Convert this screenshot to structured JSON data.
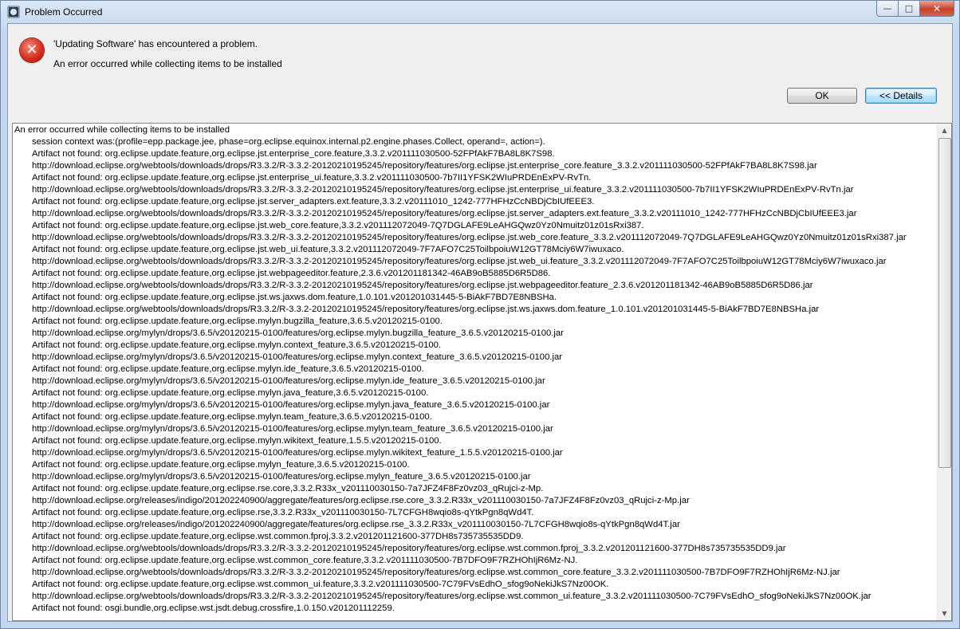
{
  "window": {
    "title": "Problem Occurred",
    "controls": {
      "minimize": "—",
      "maximize": "□",
      "close": "✕"
    }
  },
  "dialog": {
    "icon": "error-icon",
    "message": "'Updating Software' has encountered a problem.",
    "detail": "An error occurred while collecting items to be installed",
    "ok_label": "OK",
    "details_label": "<< Details"
  },
  "details": {
    "lines": [
      "An error occurred while collecting items to be installed",
      "session context was:(profile=epp.package.jee, phase=org.eclipse.equinox.internal.p2.engine.phases.Collect, operand=, action=).",
      "Artifact not found: org.eclipse.update.feature,org.eclipse.jst.enterprise_core.feature,3.3.2.v201111030500-52FPfAkF7BA8L8K7S98.",
      "http://download.eclipse.org/webtools/downloads/drops/R3.3.2/R-3.3.2-20120210195245/repository/features/org.eclipse.jst.enterprise_core.feature_3.3.2.v201111030500-52FPfAkF7BA8L8K7S98.jar",
      "Artifact not found: org.eclipse.update.feature,org.eclipse.jst.enterprise_ui.feature,3.3.2.v201111030500-7b7II1YFSK2WIuPRDEnExPV-RvTn.",
      "http://download.eclipse.org/webtools/downloads/drops/R3.3.2/R-3.3.2-20120210195245/repository/features/org.eclipse.jst.enterprise_ui.feature_3.3.2.v201111030500-7b7II1YFSK2WIuPRDEnExPV-RvTn.jar",
      "Artifact not found: org.eclipse.update.feature,org.eclipse.jst.server_adapters.ext.feature,3.3.2.v20111010_1242-777HFHzCcNBDjCbIUfEEE3.",
      "http://download.eclipse.org/webtools/downloads/drops/R3.3.2/R-3.3.2-20120210195245/repository/features/org.eclipse.jst.server_adapters.ext.feature_3.3.2.v20111010_1242-777HFHzCcNBDjCbIUfEEE3.jar",
      "Artifact not found: org.eclipse.update.feature,org.eclipse.jst.web_core.feature,3.3.2.v201112072049-7Q7DGLAFE9LeAHGQwz0Yz0Nmuitz01z01sRxi387.",
      "http://download.eclipse.org/webtools/downloads/drops/R3.3.2/R-3.3.2-20120210195245/repository/features/org.eclipse.jst.web_core.feature_3.3.2.v201112072049-7Q7DGLAFE9LeAHGQwz0Yz0Nmuitz01z01sRxi387.jar",
      "Artifact not found: org.eclipse.update.feature,org.eclipse.jst.web_ui.feature,3.3.2.v201112072049-7F7AFO7C25ToilbpoiuW12GT78Mciy6W7iwuxaco.",
      "http://download.eclipse.org/webtools/downloads/drops/R3.3.2/R-3.3.2-20120210195245/repository/features/org.eclipse.jst.web_ui.feature_3.3.2.v201112072049-7F7AFO7C25ToilbpoiuW12GT78Mciy6W7iwuxaco.jar",
      "Artifact not found: org.eclipse.update.feature,org.eclipse.jst.webpageeditor.feature,2.3.6.v201201181342-46AB9oB5885D6R5D86.",
      "http://download.eclipse.org/webtools/downloads/drops/R3.3.2/R-3.3.2-20120210195245/repository/features/org.eclipse.jst.webpageeditor.feature_2.3.6.v201201181342-46AB9oB5885D6R5D86.jar",
      "Artifact not found: org.eclipse.update.feature,org.eclipse.jst.ws.jaxws.dom.feature,1.0.101.v201201031445-5-BiAkF7BD7E8NBSHa.",
      "http://download.eclipse.org/webtools/downloads/drops/R3.3.2/R-3.3.2-20120210195245/repository/features/org.eclipse.jst.ws.jaxws.dom.feature_1.0.101.v201201031445-5-BiAkF7BD7E8NBSHa.jar",
      "Artifact not found: org.eclipse.update.feature,org.eclipse.mylyn.bugzilla_feature,3.6.5.v20120215-0100.",
      "http://download.eclipse.org/mylyn/drops/3.6.5/v20120215-0100/features/org.eclipse.mylyn.bugzilla_feature_3.6.5.v20120215-0100.jar",
      "Artifact not found: org.eclipse.update.feature,org.eclipse.mylyn.context_feature,3.6.5.v20120215-0100.",
      "http://download.eclipse.org/mylyn/drops/3.6.5/v20120215-0100/features/org.eclipse.mylyn.context_feature_3.6.5.v20120215-0100.jar",
      "Artifact not found: org.eclipse.update.feature,org.eclipse.mylyn.ide_feature,3.6.5.v20120215-0100.",
      "http://download.eclipse.org/mylyn/drops/3.6.5/v20120215-0100/features/org.eclipse.mylyn.ide_feature_3.6.5.v20120215-0100.jar",
      "Artifact not found: org.eclipse.update.feature,org.eclipse.mylyn.java_feature,3.6.5.v20120215-0100.",
      "http://download.eclipse.org/mylyn/drops/3.6.5/v20120215-0100/features/org.eclipse.mylyn.java_feature_3.6.5.v20120215-0100.jar",
      "Artifact not found: org.eclipse.update.feature,org.eclipse.mylyn.team_feature,3.6.5.v20120215-0100.",
      "http://download.eclipse.org/mylyn/drops/3.6.5/v20120215-0100/features/org.eclipse.mylyn.team_feature_3.6.5.v20120215-0100.jar",
      "Artifact not found: org.eclipse.update.feature,org.eclipse.mylyn.wikitext_feature,1.5.5.v20120215-0100.",
      "http://download.eclipse.org/mylyn/drops/3.6.5/v20120215-0100/features/org.eclipse.mylyn.wikitext_feature_1.5.5.v20120215-0100.jar",
      "Artifact not found: org.eclipse.update.feature,org.eclipse.mylyn_feature,3.6.5.v20120215-0100.",
      "http://download.eclipse.org/mylyn/drops/3.6.5/v20120215-0100/features/org.eclipse.mylyn_feature_3.6.5.v20120215-0100.jar",
      "Artifact not found: org.eclipse.update.feature,org.eclipse.rse.core,3.3.2.R33x_v201110030150-7a7JFZ4F8Fz0vz03_qRujci-z-Mp.",
      "http://download.eclipse.org/releases/indigo/201202240900/aggregate/features/org.eclipse.rse.core_3.3.2.R33x_v201110030150-7a7JFZ4F8Fz0vz03_qRujci-z-Mp.jar",
      "Artifact not found: org.eclipse.update.feature,org.eclipse.rse,3.3.2.R33x_v201110030150-7L7CFGH8wqio8s-qYtkPgn8qWd4T.",
      "http://download.eclipse.org/releases/indigo/201202240900/aggregate/features/org.eclipse.rse_3.3.2.R33x_v201110030150-7L7CFGH8wqio8s-qYtkPgn8qWd4T.jar",
      "Artifact not found: org.eclipse.update.feature,org.eclipse.wst.common.fproj,3.3.2.v201201121600-377DH8s735735535DD9.",
      "http://download.eclipse.org/webtools/downloads/drops/R3.3.2/R-3.3.2-20120210195245/repository/features/org.eclipse.wst.common.fproj_3.3.2.v201201121600-377DH8s735735535DD9.jar",
      "Artifact not found: org.eclipse.update.feature,org.eclipse.wst.common_core.feature,3.3.2.v201111030500-7B7DFO9F7RZHOhIjR6Mz-NJ.",
      "http://download.eclipse.org/webtools/downloads/drops/R3.3.2/R-3.3.2-20120210195245/repository/features/org.eclipse.wst.common_core.feature_3.3.2.v201111030500-7B7DFO9F7RZHOhIjR6Mz-NJ.jar",
      "Artifact not found: org.eclipse.update.feature,org.eclipse.wst.common_ui.feature,3.3.2.v201111030500-7C79FVsEdhO_sfog9oNekiJkS7Nz00OK.",
      "http://download.eclipse.org/webtools/downloads/drops/R3.3.2/R-3.3.2-20120210195245/repository/features/org.eclipse.wst.common_ui.feature_3.3.2.v201111030500-7C79FVsEdhO_sfog9oNekiJkS7Nz00OK.jar",
      "Artifact not found: osgi.bundle,org.eclipse.wst.jsdt.debug.crossfire,1.0.150.v201201112259."
    ]
  }
}
